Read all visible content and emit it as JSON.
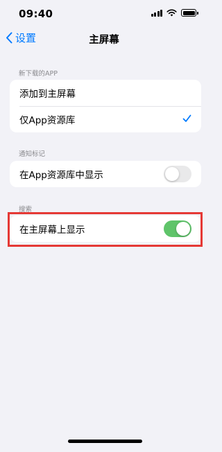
{
  "status_bar": {
    "time": "09:40"
  },
  "nav": {
    "back_label": "设置",
    "title": "主屏幕"
  },
  "sections": {
    "new_apps": {
      "header": "新下载的APP",
      "options": [
        {
          "label": "添加到主屏幕",
          "selected": false
        },
        {
          "label": "仅App资源库",
          "selected": true
        }
      ]
    },
    "badges": {
      "header": "通知标记",
      "row": {
        "label": "在App资源库中显示",
        "toggle_on": false
      }
    },
    "search": {
      "header": "搜索",
      "row": {
        "label": "在主屏幕上显示",
        "toggle_on": true
      }
    }
  },
  "colors": {
    "accent": "#007aff",
    "toggle_on": "#5fc46a",
    "highlight": "#e53935",
    "background": "#f2f2f7"
  },
  "icons": [
    "wifi-icon",
    "battery-icon",
    "signal-icon",
    "chevron-left-icon",
    "checkmark-icon"
  ]
}
